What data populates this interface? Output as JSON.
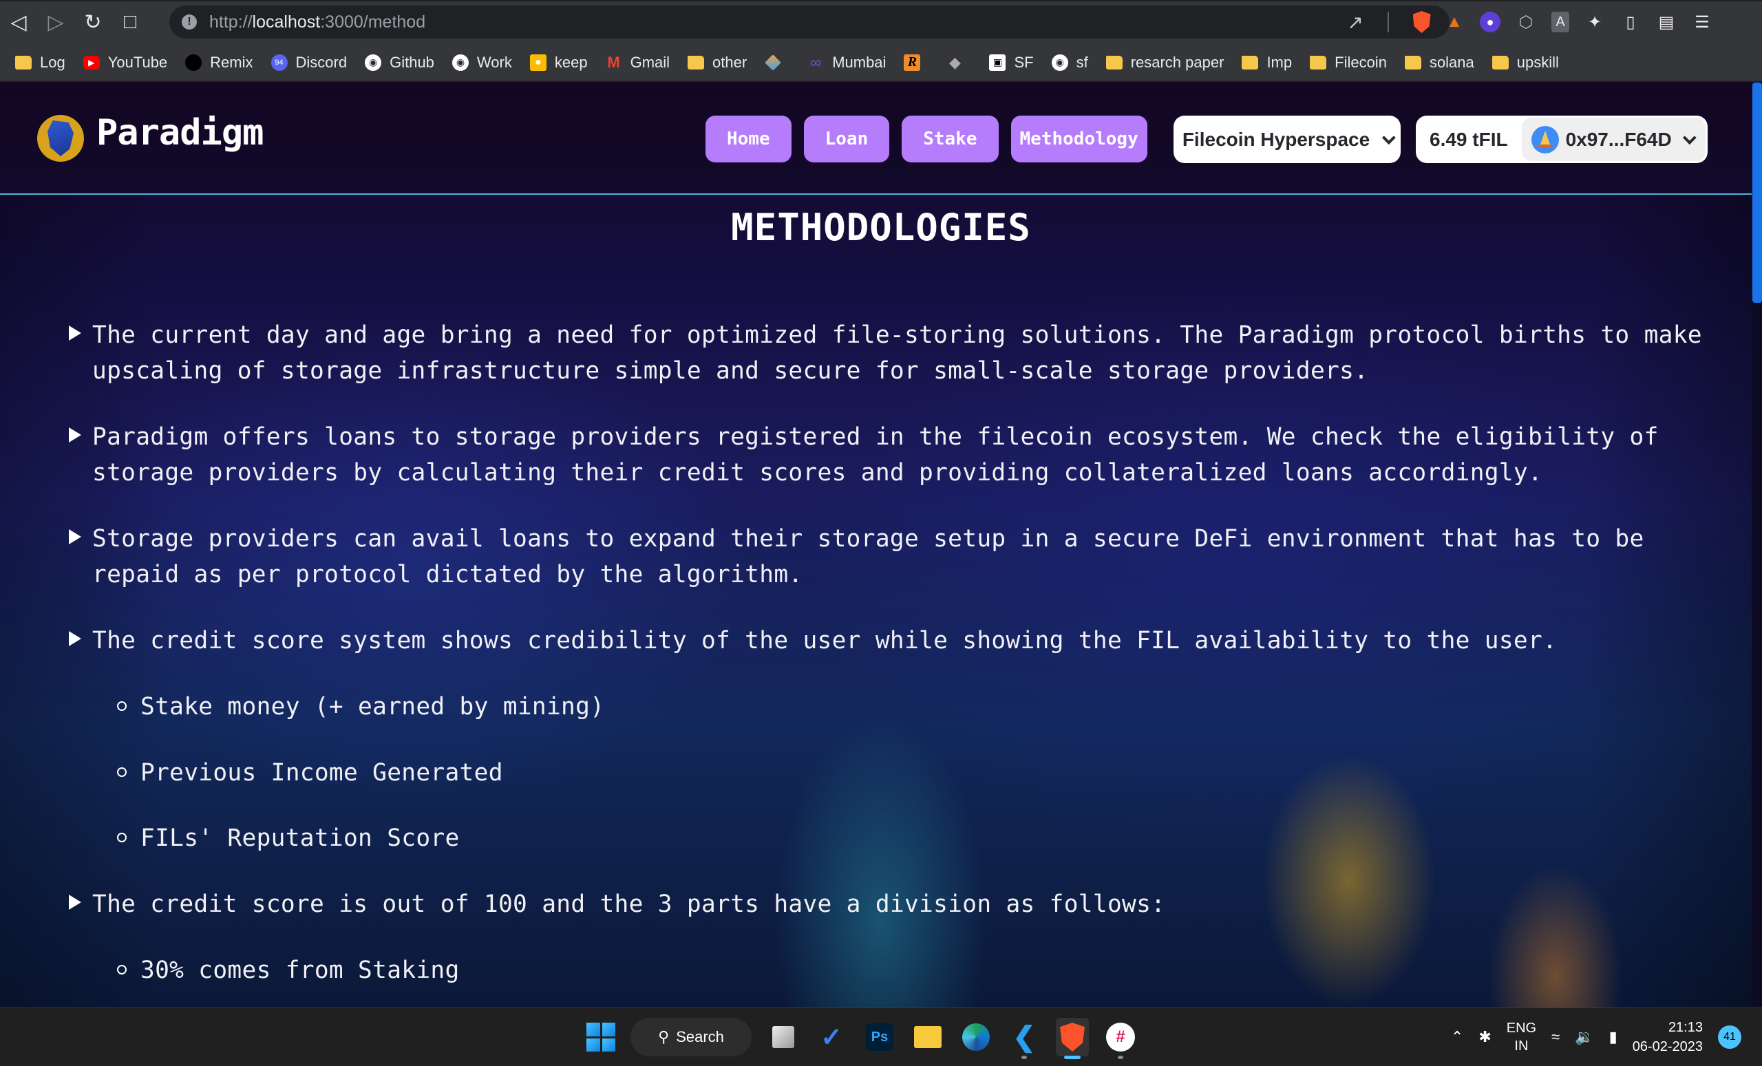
{
  "browser": {
    "url_scheme": "http://",
    "url_host": "localhost",
    "url_path": ":3000/method",
    "icons": {
      "back": "back-arrow-icon",
      "forward": "forward-arrow-icon",
      "reload": "reload-icon",
      "bookmark": "bookmark-icon",
      "site_info": "info-icon",
      "share": "share-icon",
      "brave_shield": "brave-shield-icon"
    },
    "extensions": [
      "metamask-fox-icon",
      "ghost-extension-icon",
      "cube-extension-icon",
      "a-extension-icon",
      "puzzle-extensions-icon",
      "sidebar-icon",
      "wallet-icon",
      "menu-icon"
    ],
    "bookmarks": [
      {
        "label": "Log",
        "icon": "folder"
      },
      {
        "label": "YouTube",
        "icon": "youtube"
      },
      {
        "label": "Remix",
        "icon": "remix"
      },
      {
        "label": "Discord",
        "icon": "discord",
        "badge": "94"
      },
      {
        "label": "Github",
        "icon": "github"
      },
      {
        "label": "Work",
        "icon": "github"
      },
      {
        "label": "keep",
        "icon": "keep"
      },
      {
        "label": "Gmail",
        "icon": "gmail"
      },
      {
        "label": "other",
        "icon": "folder"
      },
      {
        "label": "",
        "icon": "stack"
      },
      {
        "label": "Mumbai",
        "icon": "polygon"
      },
      {
        "label": "",
        "icon": "r-app"
      },
      {
        "label": "",
        "icon": "ethereum"
      },
      {
        "label": "SF",
        "icon": "sf"
      },
      {
        "label": "sf",
        "icon": "github"
      },
      {
        "label": "resarch paper",
        "icon": "folder"
      },
      {
        "label": "Imp",
        "icon": "folder"
      },
      {
        "label": "Filecoin",
        "icon": "folder"
      },
      {
        "label": "solana",
        "icon": "folder"
      },
      {
        "label": "upskill",
        "icon": "folder"
      }
    ]
  },
  "app": {
    "brand": "Paradigm",
    "nav": [
      {
        "label": "Home"
      },
      {
        "label": "Loan"
      },
      {
        "label": "Stake"
      },
      {
        "label": "Methodology"
      }
    ],
    "network": "Filecoin Hyperspace",
    "balance": "6.49 tFIL",
    "address": "0x97...F64D",
    "accent_color": "#b57cfb"
  },
  "content": {
    "title": "METHODOLOGIES",
    "items": [
      {
        "text": "The current day and age bring a need for optimized file-storing solutions. The Paradigm protocol births to make upscaling of storage infrastructure simple and secure for small-scale storage providers."
      },
      {
        "text": "Paradigm offers loans to storage providers registered in the filecoin ecosystem. We check the eligibility of storage providers by calculating their credit scores and providing collateralized loans accordingly."
      },
      {
        "text": "Storage providers can avail loans to expand their storage setup in a secure DeFi environment that has to be repaid as per protocol dictated by the algorithm."
      },
      {
        "text": "The credit score system shows credibility of the user while showing the FIL availability to the user."
      },
      {
        "text": "The credit score is out of 100 and the 3 parts have a division as follows:"
      }
    ],
    "credit_factors": [
      "Stake money (+ earned by mining)",
      "Previous Income Generated",
      "FILs' Reputation Score"
    ],
    "division": [
      "30% comes from Staking"
    ]
  },
  "taskbar": {
    "search_label": "Search",
    "apps": [
      "windows-start",
      "task-view",
      "todo",
      "photoshop",
      "file-explorer",
      "edge",
      "vscode",
      "brave",
      "slack"
    ],
    "active_app": "brave",
    "lang_line1": "ENG",
    "lang_line2": "IN",
    "time": "21:13",
    "date": "06-02-2023",
    "notifications": "41"
  }
}
